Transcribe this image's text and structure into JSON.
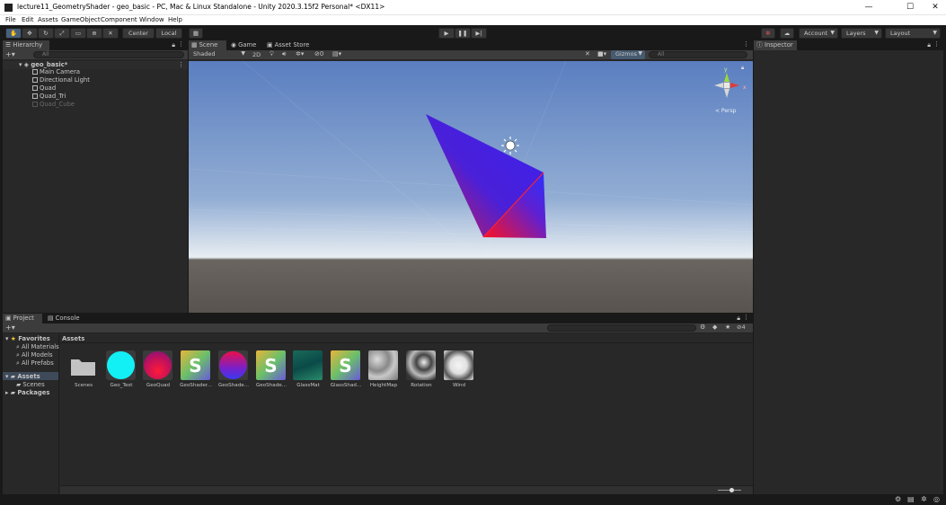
{
  "window": {
    "title": "lecture11_GeometryShader - geo_basic - PC, Mac & Linux Standalone - Unity 2020.3.15f2 Personal* <DX11>",
    "minimize": "—",
    "maximize": "☐",
    "close": "✕"
  },
  "menu": [
    "File",
    "Edit",
    "Assets",
    "GameObject",
    "Component",
    "Window",
    "Help"
  ],
  "toolbar": {
    "center_label": "Center",
    "local_label": "Local",
    "account_label": "Account",
    "layers_label": "Layers",
    "layout_label": "Layout"
  },
  "hierarchy": {
    "tab": "Hierarchy",
    "search_placeholder": "All",
    "scene": "geo_basic*",
    "items": [
      "Main Camera",
      "Directional Light",
      "Quad",
      "Quad_Tri",
      "Quad_Cube"
    ]
  },
  "scene": {
    "tabs": [
      "Scene",
      "Game",
      "Asset Store"
    ],
    "shading": "Shaded",
    "mode2d": "2D",
    "fx_count": "0",
    "gizmos": "Gizmos",
    "search_placeholder": "All",
    "persp": "< Persp",
    "axis_y": "y",
    "axis_x": "x"
  },
  "inspector": {
    "tab": "Inspector"
  },
  "project": {
    "tabs": [
      "Project",
      "Console"
    ],
    "favorites_label": "Favorites",
    "favorites": [
      "All Materials",
      "All Models",
      "All Prefabs"
    ],
    "assets_label": "Assets",
    "scenes_label": "Scenes",
    "packages_label": "Packages",
    "breadcrumb": "Assets",
    "hidden_count": "4",
    "assets": [
      {
        "name": "Scenes",
        "kind": "folder"
      },
      {
        "name": "Geo_Test",
        "kind": "material-cyan"
      },
      {
        "name": "GeoQuad",
        "kind": "material-redpurple"
      },
      {
        "name": "GeoShader...",
        "kind": "shader"
      },
      {
        "name": "GeoShade...",
        "kind": "material-redblue"
      },
      {
        "name": "GeoShade...",
        "kind": "shader"
      },
      {
        "name": "GlassMat",
        "kind": "material-teal"
      },
      {
        "name": "GlassShad...",
        "kind": "shader"
      },
      {
        "name": "HeightMap",
        "kind": "texture-noise"
      },
      {
        "name": "Rotation",
        "kind": "texture-rock"
      },
      {
        "name": "Wind",
        "kind": "texture-wind"
      }
    ]
  },
  "colors": {
    "panel": "#282828",
    "tab_selected": "#3c3c3c",
    "sky_top": "#5b7fc0",
    "ground": "#5a5550",
    "accent_red": "#e03a3a"
  }
}
